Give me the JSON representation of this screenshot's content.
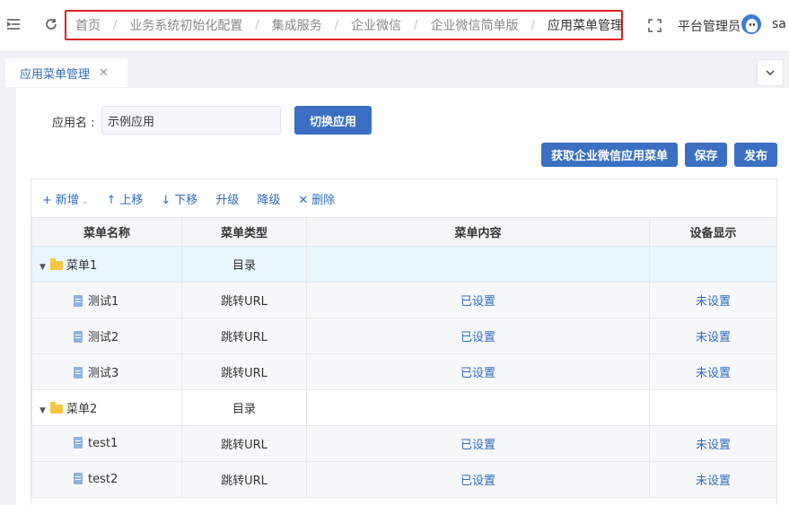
{
  "header": {
    "breadcrumb": [
      "首页",
      "业务系统初始化配置",
      "集成服务",
      "企业微信",
      "企业微信简单版",
      "应用菜单管理"
    ],
    "separator": "/",
    "user_name": "平台管理员",
    "user_id": "sa"
  },
  "tabs": [
    {
      "label": "应用菜单管理"
    }
  ],
  "form": {
    "app_label": "应用名 :",
    "app_value": "示例应用"
  },
  "buttons": {
    "switch_app": "切换应用",
    "fetch_menu": "获取企业微信应用菜单",
    "save": "保存",
    "publish": "发布"
  },
  "toolbar": {
    "add": "新增",
    "move_up": "上移",
    "move_down": "下移",
    "upgrade": "升级",
    "downgrade": "降级",
    "delete": "删除"
  },
  "table": {
    "columns": [
      "菜单名称",
      "菜单类型",
      "菜单内容",
      "设备显示"
    ],
    "rows": [
      {
        "name": "菜单1",
        "type": "目录",
        "content": "",
        "device": ""
      },
      {
        "name": "测试1",
        "type": "跳转URL",
        "content": "已设置",
        "device": "未设置"
      },
      {
        "name": "测试2",
        "type": "跳转URL",
        "content": "已设置",
        "device": "未设置"
      },
      {
        "name": "测试3",
        "type": "跳转URL",
        "content": "已设置",
        "device": "未设置"
      },
      {
        "name": "菜单2",
        "type": "目录",
        "content": "",
        "device": ""
      },
      {
        "name": "test1",
        "type": "跳转URL",
        "content": "已设置",
        "device": "未设置"
      },
      {
        "name": "test2",
        "type": "跳转URL",
        "content": "已设置",
        "device": "未设置"
      }
    ]
  },
  "colors": {
    "accent": "#3a6fc4",
    "link": "#2d6cc0",
    "highlight_border": "#e02020",
    "selected_row": "#e8f6fd"
  }
}
